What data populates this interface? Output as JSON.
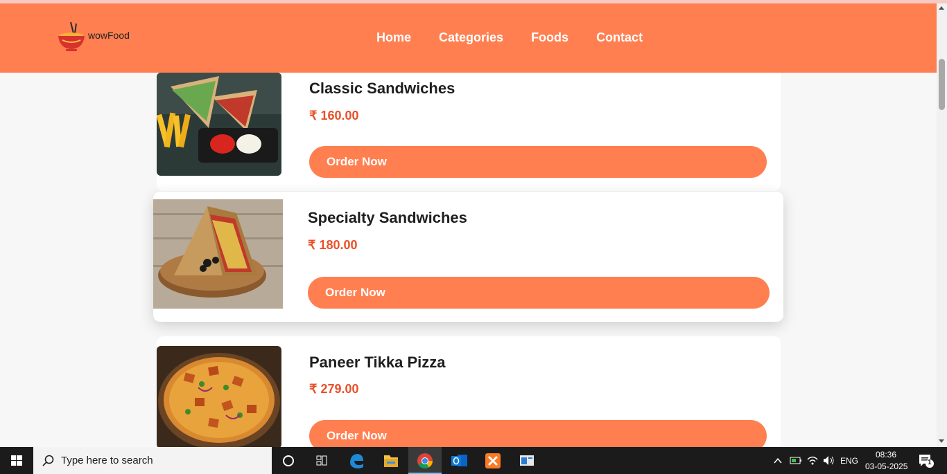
{
  "brand": {
    "name": "wowFood",
    "tagline": "",
    "accent_color": "#ff7f50",
    "price_color": "#e8512a"
  },
  "nav": [
    {
      "label": "Home"
    },
    {
      "label": "Categories"
    },
    {
      "label": "Foods"
    },
    {
      "label": "Contact"
    }
  ],
  "foods": [
    {
      "title": "Classic Sandwiches",
      "price": "₹ 160.00",
      "button": "Order Now",
      "image": "club-sandwich-with-fries-and-dips"
    },
    {
      "title": "Specialty Sandwiches",
      "price": "₹ 180.00",
      "button": "Order Now",
      "image": "triangle-sandwich-on-wooden-board"
    },
    {
      "title": "Paneer Tikka Pizza",
      "price": "₹ 279.00",
      "button": "Order Now",
      "image": "paneer-tikka-pizza"
    }
  ],
  "taskbar": {
    "search_placeholder": "Type here to search",
    "apps": [
      "task-view-icon",
      "edge-icon",
      "file-explorer-icon",
      "chrome-icon",
      "outlook-icon",
      "xampp-icon",
      "app-window-icon"
    ],
    "language": "ENG",
    "time": "08:36",
    "date": "03-05-2025",
    "notification_count": "1"
  }
}
